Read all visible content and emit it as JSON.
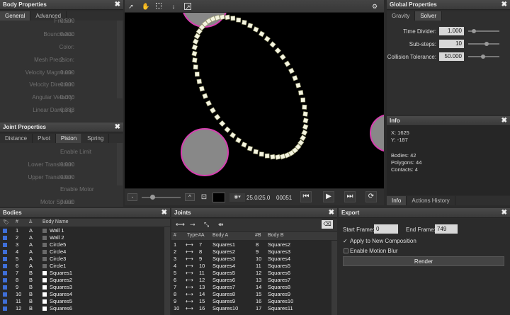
{
  "body_props": {
    "title": "Body Properties",
    "tabs": [
      "General",
      "Advanced"
    ],
    "rows": [
      {
        "label": "Friction:",
        "value": "0.500"
      },
      {
        "label": "Bounciness:",
        "value": "0.300"
      },
      {
        "label": "Color:",
        "value": ""
      },
      {
        "label": "Mesh Precision:",
        "value": "2"
      },
      {
        "label": "Velocity Magnitude:",
        "value": "0.000"
      },
      {
        "label": "Velocity Direction:",
        "value": "0.000"
      },
      {
        "label": "Angular Velocity:",
        "value": "0.000"
      },
      {
        "label": "Linear Damping:",
        "value": "0.333"
      }
    ]
  },
  "joint_props": {
    "title": "Joint Properties",
    "tabs": [
      "Distance",
      "Pivot",
      "Piston",
      "Spring"
    ],
    "rows": [
      {
        "label": "",
        "value": "Enable Limit"
      },
      {
        "label": "Lower Translation:",
        "value": "0.000"
      },
      {
        "label": "Upper Translation:",
        "value": "0.000"
      },
      {
        "label": "",
        "value": "Enable Motor"
      },
      {
        "label": "Motor Speed:",
        "value": "0.000"
      }
    ]
  },
  "viewport": {
    "frame_text": "25.0/25.0",
    "frame_number": "00051"
  },
  "global_props": {
    "title": "Global Properties",
    "tabs": [
      "Gravity",
      "Solver"
    ],
    "rows": [
      {
        "label": "Time Divider:",
        "value": "1.000"
      },
      {
        "label": "Sub-steps:",
        "value": "10"
      },
      {
        "label": "Collision Tolerance:",
        "value": "50.000"
      }
    ]
  },
  "info": {
    "title": "Info",
    "x": "X: 1625",
    "y": "Y: -187",
    "bodies": "Bodies: 42",
    "polygons": "Polygons: 44",
    "contacts": "Contacts: 4",
    "tabs": [
      "Info",
      "Actions History"
    ]
  },
  "bodies": {
    "title": "Bodies",
    "headers": {
      "num": "#",
      "type": "",
      "name": "Body Name"
    },
    "rows": [
      {
        "num": "1",
        "type": "A",
        "name": "Wall 1",
        "color": "#6a6a6a"
      },
      {
        "num": "2",
        "type": "A",
        "name": "Wall 2",
        "color": "#6a6a6a"
      },
      {
        "num": "3",
        "type": "A",
        "name": "Circle5",
        "color": "#6a6a6a"
      },
      {
        "num": "4",
        "type": "A",
        "name": "Circle4",
        "color": "#6a6a6a"
      },
      {
        "num": "5",
        "type": "A",
        "name": "Circle3",
        "color": "#6a6a6a"
      },
      {
        "num": "6",
        "type": "A",
        "name": "Circle1",
        "color": "#6a6a6a"
      },
      {
        "num": "7",
        "type": "B",
        "name": "Squares1",
        "color": "#ffffff"
      },
      {
        "num": "8",
        "type": "B",
        "name": "Squares2",
        "color": "#ffffff"
      },
      {
        "num": "9",
        "type": "B",
        "name": "Squares3",
        "color": "#ffffff"
      },
      {
        "num": "10",
        "type": "B",
        "name": "Squares4",
        "color": "#ffffff"
      },
      {
        "num": "11",
        "type": "B",
        "name": "Squares5",
        "color": "#ffffff"
      },
      {
        "num": "12",
        "type": "B",
        "name": "Squares6",
        "color": "#ffffff"
      }
    ]
  },
  "joints": {
    "title": "Joints",
    "headers": {
      "num": "#",
      "type": "Type",
      "a": "#A",
      "bodyA": "Body A",
      "b": "#B",
      "bodyB": "Body B"
    },
    "rows": [
      {
        "num": "1",
        "a": "7",
        "bodyA": "Squares1",
        "b": "8",
        "bodyB": "Squares2"
      },
      {
        "num": "2",
        "a": "8",
        "bodyA": "Squares2",
        "b": "9",
        "bodyB": "Squares3"
      },
      {
        "num": "3",
        "a": "9",
        "bodyA": "Squares3",
        "b": "10",
        "bodyB": "Squares4"
      },
      {
        "num": "4",
        "a": "10",
        "bodyA": "Squares4",
        "b": "11",
        "bodyB": "Squares5"
      },
      {
        "num": "5",
        "a": "11",
        "bodyA": "Squares5",
        "b": "12",
        "bodyB": "Squares6"
      },
      {
        "num": "6",
        "a": "12",
        "bodyA": "Squares6",
        "b": "13",
        "bodyB": "Squares7"
      },
      {
        "num": "7",
        "a": "13",
        "bodyA": "Squares7",
        "b": "14",
        "bodyB": "Squares8"
      },
      {
        "num": "8",
        "a": "14",
        "bodyA": "Squares8",
        "b": "15",
        "bodyB": "Squares9"
      },
      {
        "num": "9",
        "a": "15",
        "bodyA": "Squares9",
        "b": "16",
        "bodyB": "Squares10"
      },
      {
        "num": "10",
        "a": "16",
        "bodyA": "Squares10",
        "b": "17",
        "bodyB": "Squares11"
      }
    ]
  },
  "export": {
    "title": "Export",
    "start_label": "Start Frame:",
    "start_value": "0",
    "end_label": "End Frame:",
    "end_value": "749",
    "apply_label": "Apply to New Composition",
    "blur_label": "Enable Motion Blur",
    "render_label": "Render"
  },
  "colors": {
    "ring": "#d63fb0",
    "circle_fill": "#888888",
    "square": "#f4f4e0",
    "accent": "#3f6fd8"
  }
}
